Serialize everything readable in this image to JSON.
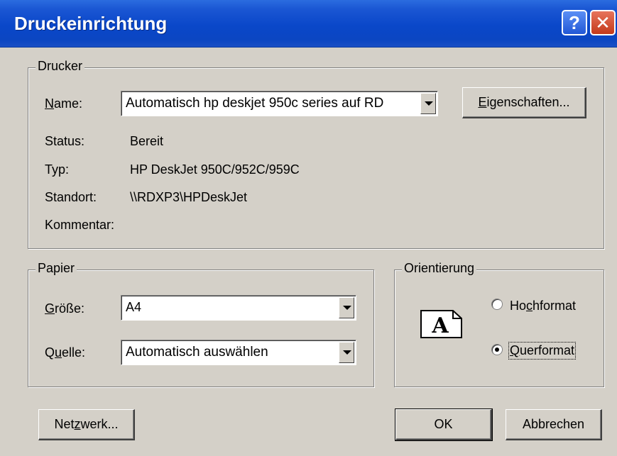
{
  "window": {
    "title": "Druckeinrichtung",
    "help_icon": "help-icon",
    "close_icon": "close-icon"
  },
  "printer": {
    "group_label": "Drucker",
    "name_label_u": "N",
    "name_label_rest": "ame:",
    "name_value": "Automatisch hp deskjet 950c series auf RD",
    "properties_u": "E",
    "properties_rest": "igenschaften...",
    "status_label": "Status:",
    "status_value": "Bereit",
    "type_label": "Typ:",
    "type_value": "HP DeskJet 950C/952C/959C",
    "location_label": "Standort:",
    "location_value": "\\\\RDXP3\\HPDeskJet",
    "comment_label": "Kommentar:",
    "comment_value": ""
  },
  "paper": {
    "group_label": "Papier",
    "size_label_u": "G",
    "size_label_rest": "röße:",
    "size_value": "A4",
    "source_label_pre": "Q",
    "source_label_u": "u",
    "source_label_rest": "elle:",
    "source_value": "Automatisch auswählen"
  },
  "orientation": {
    "group_label": "Orientierung",
    "icon_letter": "A",
    "portrait_pre": "Ho",
    "portrait_u": "c",
    "portrait_rest": "hformat",
    "landscape_u": "Q",
    "landscape_rest": "uerformat",
    "selected": "landscape"
  },
  "buttons": {
    "network_pre": "Net",
    "network_u": "z",
    "network_rest": "werk...",
    "ok": "OK",
    "cancel": "Abbrechen"
  }
}
